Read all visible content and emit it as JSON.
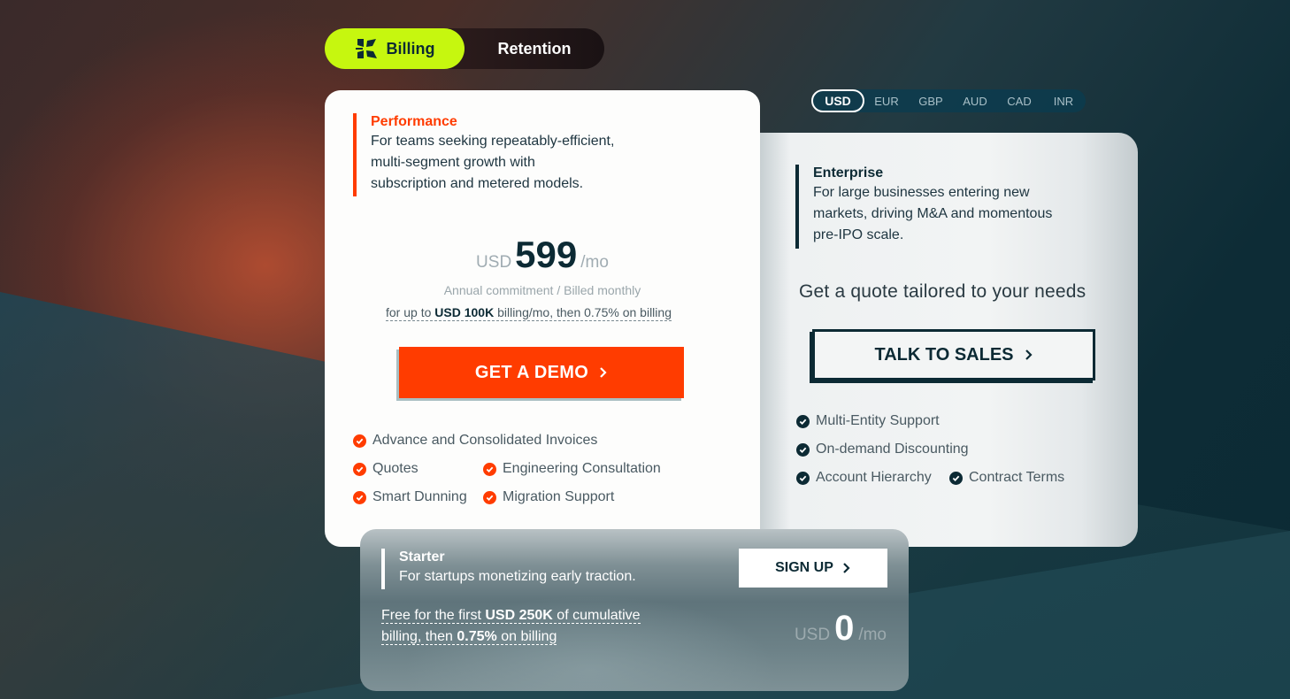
{
  "tabs": [
    {
      "label": "Billing",
      "active": true,
      "icon": "logo-icon"
    },
    {
      "label": "Retention",
      "active": false
    }
  ],
  "currency": {
    "options": [
      "USD",
      "EUR",
      "GBP",
      "AUD",
      "CAD",
      "INR"
    ],
    "selected": "USD"
  },
  "plans": {
    "performance": {
      "name": "Performance",
      "description_lines": [
        "For teams seeking repeatably-efficient,",
        "multi-segment growth with",
        "subscription and metered models."
      ],
      "currency": "USD",
      "price": "599",
      "period": "/mo",
      "commitment": "Annual commitment / Billed monthly",
      "limit_prefix": "for up to ",
      "limit_bold": "USD 100K",
      "limit_suffix": " billing/mo, then 0.75% on billing",
      "cta": "GET A DEMO",
      "features": [
        "Advance and Consolidated Invoices",
        "Quotes",
        "Engineering Consultation",
        "Smart Dunning",
        "Migration Support"
      ],
      "accent": "#ff3c00"
    },
    "enterprise": {
      "name": "Enterprise",
      "description_lines": [
        "For large businesses entering new",
        "markets, driving M&A and momentous",
        "pre-IPO scale."
      ],
      "quote_text": "Get a quote tailored to your needs",
      "cta": "TALK TO SALES",
      "features": [
        "Multi-Entity Support",
        "On-demand Discounting",
        "Account Hierarchy",
        "Contract Terms"
      ],
      "accent": "#0c2a34"
    },
    "starter": {
      "name": "Starter",
      "description": "For startups monetizing early traction.",
      "free_prefix": "Free for the first ",
      "free_bold": "USD 250K",
      "free_mid": " of cumulative billing, then ",
      "free_bold2": "0.75%",
      "free_suffix": " on billing",
      "cta": "SIGN UP",
      "currency": "USD",
      "price": "0",
      "period": "/mo"
    }
  },
  "colors": {
    "billing_tab": "#c6f70f",
    "primary_dark": "#0c2a34",
    "cta_orange": "#ff3c00"
  }
}
